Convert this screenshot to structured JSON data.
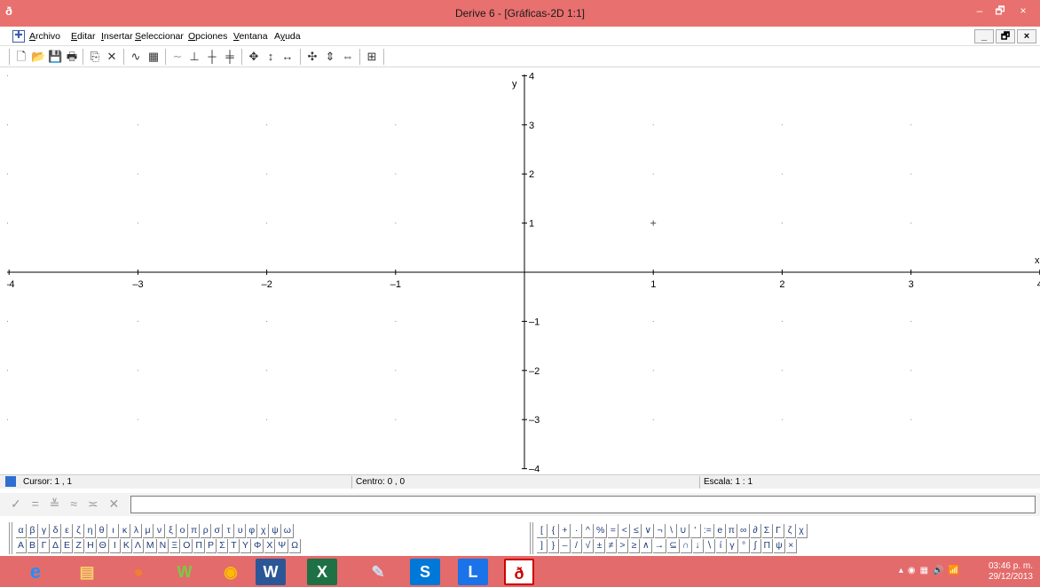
{
  "window": {
    "title": "Derive 6 - [Gráficas-2D 1:1]",
    "minimize": "–",
    "maximize": "🗗",
    "close": "×"
  },
  "menu": [
    {
      "label": "Archivo",
      "acc": "A",
      "rest": "rchivo"
    },
    {
      "label": "Editar",
      "acc": "E",
      "rest": "ditar"
    },
    {
      "label": "Insertar",
      "acc": "I",
      "rest": "nsertar"
    },
    {
      "label": "Seleccionar",
      "acc": "S",
      "rest": "eleccionar"
    },
    {
      "label": "Opciones",
      "acc": "O",
      "rest": "pciones"
    },
    {
      "label": "Ventana",
      "acc": "V",
      "rest": "entana"
    },
    {
      "label": "Ayuda",
      "acc": "y",
      "pre": "A",
      "rest": "uda"
    }
  ],
  "mdi": {
    "minimize": "_",
    "restore": "🗗",
    "close": "×"
  },
  "plot": {
    "x_label": "x",
    "y_label": "y",
    "x_ticks": [
      "–4",
      "–3",
      "–2",
      "–1",
      "1",
      "2",
      "3",
      "4"
    ],
    "y_ticks": [
      "4",
      "3",
      "2",
      "1",
      "–1",
      "–2",
      "–3",
      "–4"
    ],
    "x_range": [
      -4,
      4
    ],
    "y_range": [
      -4,
      4
    ],
    "cursor_marker": {
      "x": 1,
      "y": 1
    },
    "grid_dots": true
  },
  "status": {
    "cursor": "Cursor: 1 , 1",
    "centro": "Centro: 0 , 0",
    "escala": "Escala: 1 : 1"
  },
  "entry": {
    "value": ""
  },
  "greek_row1": [
    "α",
    "β",
    "γ",
    "δ",
    "ε",
    "ζ",
    "η",
    "θ",
    "ι",
    "κ",
    "λ",
    "μ",
    "ν",
    "ξ",
    "ο",
    "π",
    "ρ",
    "σ",
    "τ",
    "υ",
    "φ",
    "χ",
    "ψ",
    "ω"
  ],
  "greek_row2": [
    "Α",
    "Β",
    "Γ",
    "Δ",
    "Ε",
    "Ζ",
    "Η",
    "Θ",
    "Ι",
    "Κ",
    "Λ",
    "Μ",
    "Ν",
    "Ξ",
    "Ο",
    "Π",
    "Ρ",
    "Σ",
    "Τ",
    "Υ",
    "Φ",
    "Χ",
    "Ψ",
    "Ω"
  ],
  "sym_row1": [
    "[",
    "{",
    "+",
    "·",
    "^",
    "%",
    "=",
    "<",
    "≤",
    "∨",
    "¬",
    "\\",
    "∪",
    "'",
    ":=",
    "e",
    "π",
    "∞",
    "∂",
    "Σ",
    "Γ",
    "ζ",
    "χ"
  ],
  "sym_row2": [
    "]",
    "}",
    "–",
    "/",
    "√",
    "±",
    "≠",
    ">",
    "≥",
    "∧",
    "→",
    "⊆",
    "∩",
    "↓",
    "∖",
    "ί",
    "γ",
    "°",
    "∫",
    "Π",
    "ψ",
    "×"
  ],
  "taskbar": {
    "time": "03:46 p. m.",
    "date": "29/12/2013"
  },
  "colors": {
    "titlebar": "#e8706f",
    "taskbar": "#e46b6b"
  }
}
